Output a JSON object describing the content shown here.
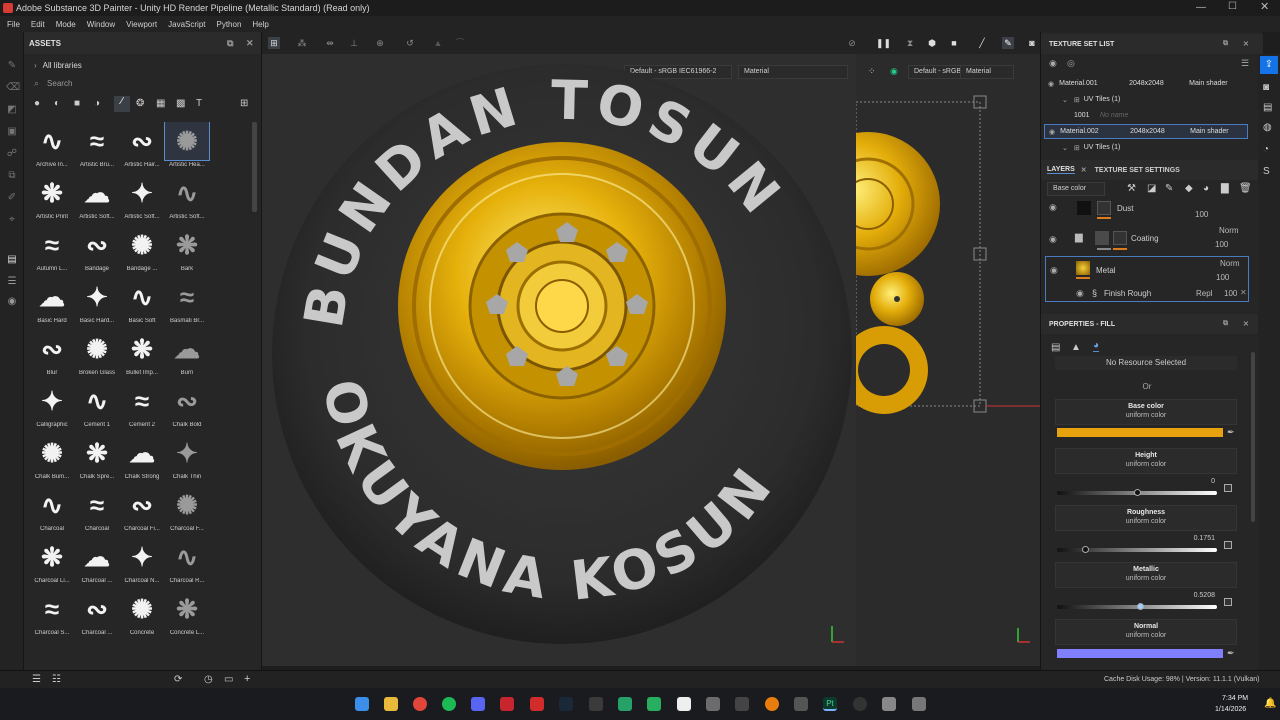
{
  "app": {
    "title": "Adobe Substance 3D Painter - Unity HD Render Pipeline (Metallic Standard) (Read only)",
    "menu": [
      "File",
      "Edit",
      "Mode",
      "Window",
      "Viewport",
      "JavaScript",
      "Python",
      "Help"
    ]
  },
  "assets": {
    "title": "ASSETS",
    "library": "All libraries",
    "search_placeholder": "Search",
    "items": [
      "Archive In...",
      "Artistic Bru...",
      "Artistic Hair...",
      "Artistic Hea...",
      "Artistic Print",
      "Artistic Soft...",
      "Artistic Soft...",
      "Artistic Soft...",
      "Autumn L...",
      "Bandage",
      "Bandage ...",
      "Bark",
      "Basic Hard",
      "Basic Hard...",
      "Basic Soft",
      "Basmati Br...",
      "Blur",
      "Broken Glass",
      "Bullet Imp...",
      "Burn",
      "Calligraphic",
      "Cement 1",
      "Cement 2",
      "Chalk Bold",
      "Chalk Bum...",
      "Chalk Spre...",
      "Chalk Strong",
      "Chalk Thin",
      "Charcoal",
      "Charcoal",
      "Charcoal Fi...",
      "Charcoal F...",
      "Charcoal Li...",
      "Charcoal ...",
      "Charcoal N...",
      "Charcoal R...",
      "Charcoal S...",
      "Charcoal ...",
      "Concrete",
      "Concrete L..."
    ],
    "selected_index": 3
  },
  "viewport": {
    "dropdown_left": "Default - sRGB IEC61966-2",
    "mode_left": "Material",
    "dropdown_right": "Default - sRGB",
    "mode_right": "Material",
    "tire_text_top": "BUNDAN TOSUN",
    "tire_text_bottom": "OKUYANA KOSUN",
    "colors": {
      "gold": "#e8b10a",
      "tire": "#2f2f2f",
      "tire_text": "#c9c9c9"
    }
  },
  "texture_set_list": {
    "title": "TEXTURE SET LIST",
    "sets": [
      {
        "name": "Material.001",
        "res": "2048x2048",
        "shader": "Main shader",
        "uv": "UV Tiles (1)",
        "tile": "1001",
        "tile_name": "No name"
      },
      {
        "name": "Material.002",
        "res": "2048x2048",
        "shader": "Main shader",
        "uv": "UV Tiles (1)"
      }
    ]
  },
  "layers": {
    "tab1": "LAYERS",
    "tab2": "TEXTURE SET SETTINGS",
    "channel": "Base color",
    "items": [
      {
        "name": "Dust",
        "blend": "",
        "opacity": "100"
      },
      {
        "name": "Coating",
        "blend": "Norm",
        "opacity": "100"
      },
      {
        "name": "Metal",
        "blend": "Norm",
        "opacity": "100"
      }
    ],
    "effect": {
      "name": "Finish Rough",
      "blend": "Repl",
      "opacity": "100"
    }
  },
  "properties": {
    "title": "PROPERTIES - FILL",
    "resource": "No Resource Selected",
    "or": "Or",
    "base_color": {
      "label": "Base color",
      "sub": "uniform color",
      "color": "#e8a20d"
    },
    "height": {
      "label": "Height",
      "sub": "uniform color",
      "value": "0",
      "fraction": 0.5
    },
    "roughness": {
      "label": "Roughness",
      "sub": "uniform color",
      "value": "0.1751",
      "fraction": 0.1751
    },
    "metallic": {
      "label": "Metallic",
      "sub": "uniform color",
      "value": "0.5208",
      "fraction": 0.5208
    },
    "normal": {
      "label": "Normal",
      "sub": "uniform color",
      "color": "#8080ff"
    }
  },
  "status": {
    "text": "Cache Disk Usage:  98% | Version: 11.1.1 (Vulkan)"
  },
  "taskbar": {
    "time": "7:34 PM",
    "date": "1/14/2026"
  }
}
